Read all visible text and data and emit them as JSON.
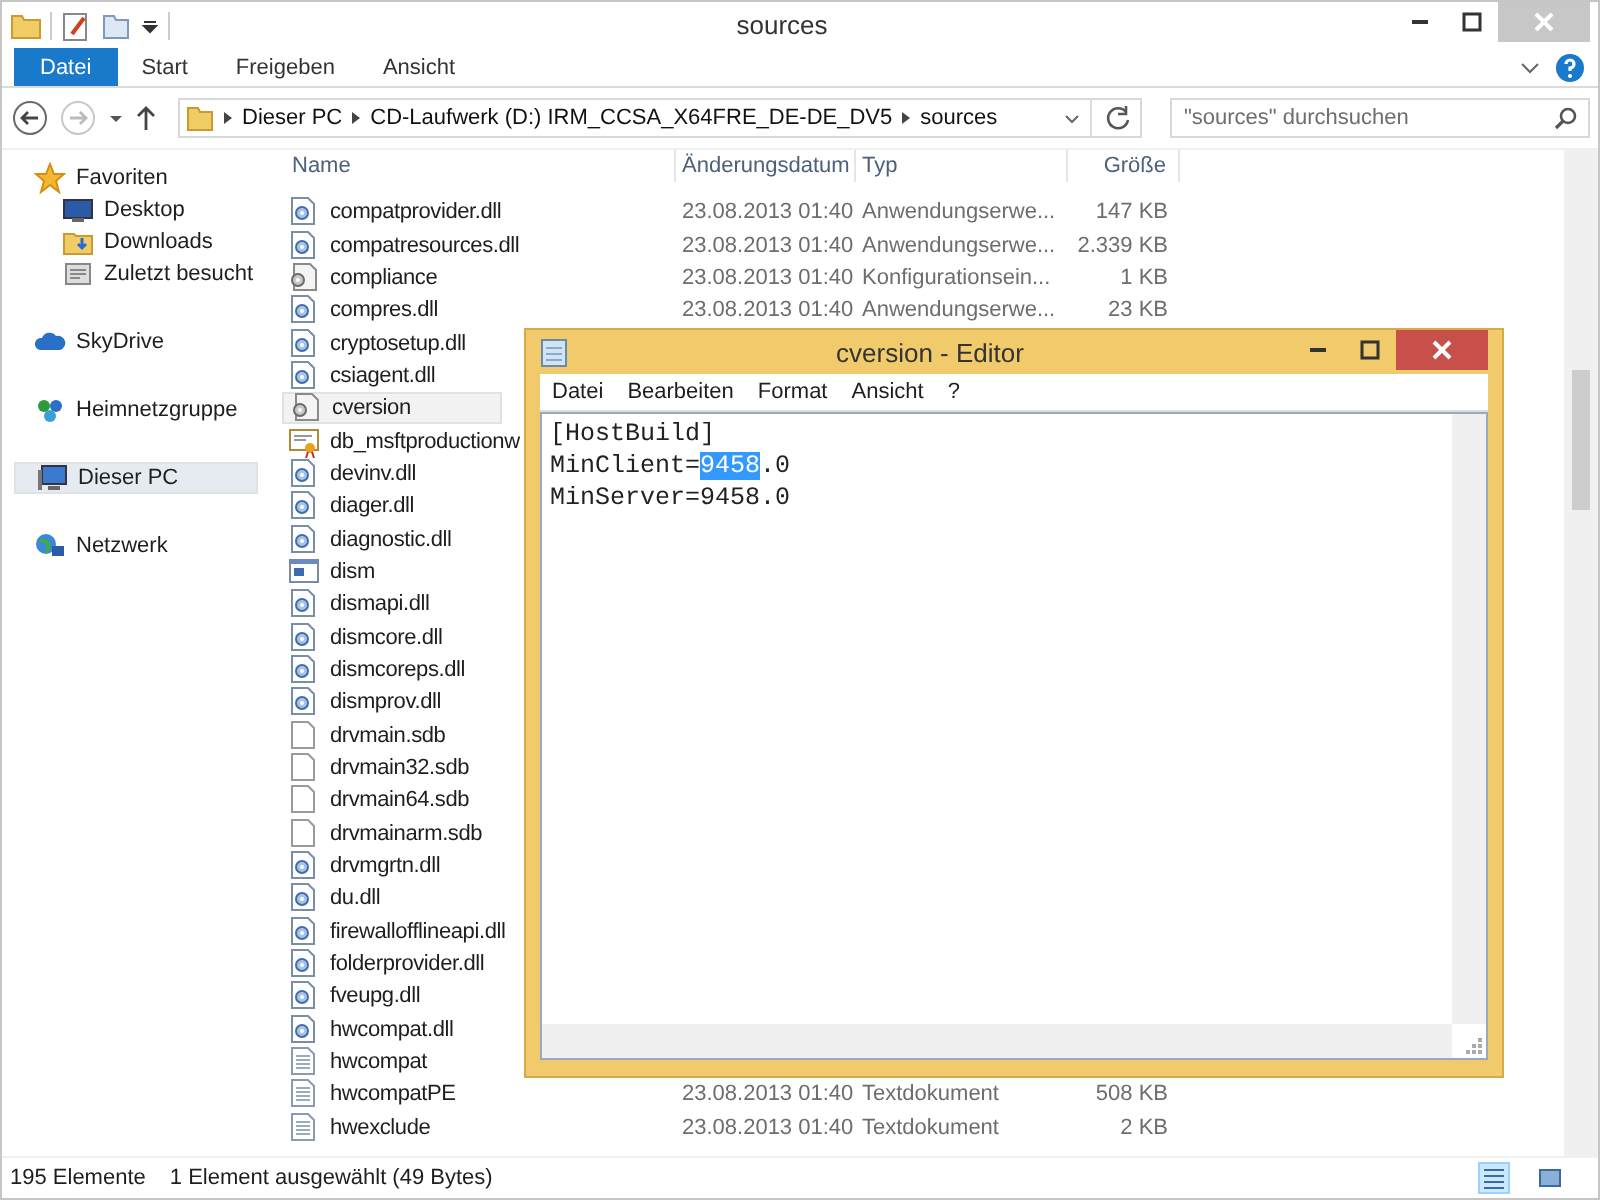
{
  "window": {
    "title": "sources"
  },
  "ribbon_tabs": [
    {
      "label": "Datei",
      "selected": true
    },
    {
      "label": "Start",
      "selected": false
    },
    {
      "label": "Freigeben",
      "selected": false
    },
    {
      "label": "Ansicht",
      "selected": false
    }
  ],
  "address_bar": {
    "breadcrumbs": [
      "Dieser PC",
      "CD-Laufwerk (D:) IRM_CCSA_X64FRE_DE-DE_DV5",
      "sources"
    ],
    "search": {
      "placeholder": "\"sources\" durchsuchen"
    }
  },
  "sidebar": {
    "groups": [
      {
        "items": [
          {
            "label": "Favoriten",
            "kind": "star",
            "selected": false,
            "children": [
              {
                "label": "Desktop",
                "kind": "desktop",
                "selected": false
              },
              {
                "label": "Downloads",
                "kind": "downloads",
                "selected": false
              },
              {
                "label": "Zuletzt besucht",
                "kind": "recent",
                "selected": false
              }
            ]
          }
        ]
      },
      {
        "items": [
          {
            "label": "SkyDrive",
            "kind": "cloud",
            "selected": false
          }
        ]
      },
      {
        "items": [
          {
            "label": "Heimnetzgruppe",
            "kind": "homegroup",
            "selected": false
          }
        ]
      },
      {
        "items": [
          {
            "label": "Dieser PC",
            "kind": "pc",
            "selected": true
          }
        ]
      },
      {
        "items": [
          {
            "label": "Netzwerk",
            "kind": "network",
            "selected": false
          }
        ]
      }
    ]
  },
  "table": {
    "columns": [
      "Name",
      "Änderungsdatum",
      "Typ",
      "Größe"
    ],
    "rows": [
      {
        "name": "compatprovider.dll",
        "kind": "dll",
        "selected": false,
        "date": "23.08.2013 01:40",
        "type": "Anwendungserwe...",
        "size": "147 KB"
      },
      {
        "name": "compatresources.dll",
        "kind": "dll",
        "selected": false,
        "date": "23.08.2013 01:40",
        "type": "Anwendungserwe...",
        "size": "2.339 KB"
      },
      {
        "name": "compliance",
        "kind": "config",
        "selected": false,
        "date": "23.08.2013 01:40",
        "type": "Konfigurationsein...",
        "size": "1 KB"
      },
      {
        "name": "compres.dll",
        "kind": "dll",
        "selected": false,
        "date": "23.08.2013 01:40",
        "type": "Anwendungserwe...",
        "size": "23 KB"
      },
      {
        "name": "cryptosetup.dll",
        "kind": "dll",
        "selected": false
      },
      {
        "name": "csiagent.dll",
        "kind": "dll",
        "selected": false
      },
      {
        "name": "cversion",
        "kind": "config",
        "selected": true
      },
      {
        "name": "db_msftproductionw",
        "kind": "cert",
        "selected": false
      },
      {
        "name": "devinv.dll",
        "kind": "dll",
        "selected": false
      },
      {
        "name": "diager.dll",
        "kind": "dll",
        "selected": false
      },
      {
        "name": "diagnostic.dll",
        "kind": "dll",
        "selected": false
      },
      {
        "name": "dism",
        "kind": "app",
        "selected": false
      },
      {
        "name": "dismapi.dll",
        "kind": "dll",
        "selected": false
      },
      {
        "name": "dismcore.dll",
        "kind": "dll",
        "selected": false
      },
      {
        "name": "dismcoreps.dll",
        "kind": "dll",
        "selected": false
      },
      {
        "name": "dismprov.dll",
        "kind": "dll",
        "selected": false
      },
      {
        "name": "drvmain.sdb",
        "kind": "file",
        "selected": false
      },
      {
        "name": "drvmain32.sdb",
        "kind": "file",
        "selected": false
      },
      {
        "name": "drvmain64.sdb",
        "kind": "file",
        "selected": false
      },
      {
        "name": "drvmainarm.sdb",
        "kind": "file",
        "selected": false
      },
      {
        "name": "drvmgrtn.dll",
        "kind": "dll",
        "selected": false
      },
      {
        "name": "du.dll",
        "kind": "dll",
        "selected": false
      },
      {
        "name": "firewallofflineapi.dll",
        "kind": "dll",
        "selected": false
      },
      {
        "name": "folderprovider.dll",
        "kind": "dll",
        "selected": false
      },
      {
        "name": "fveupg.dll",
        "kind": "dll",
        "selected": false
      },
      {
        "name": "hwcompat.dll",
        "kind": "dll",
        "selected": false
      },
      {
        "name": "hwcompat",
        "kind": "text",
        "selected": false
      },
      {
        "name": "hwcompatPE",
        "kind": "text",
        "selected": false,
        "date": "23.08.2013 01:40",
        "type": "Textdokument",
        "size": "508 KB"
      },
      {
        "name": "hwexclude",
        "kind": "text",
        "selected": false,
        "date": "23.08.2013 01:40",
        "type": "Textdokument",
        "size": "2 KB"
      }
    ]
  },
  "status_bar": {
    "count": "195 Elemente",
    "selection": "1 Element ausgewählt (49 Bytes)",
    "views": [
      {
        "kind": "details",
        "selected": true
      },
      {
        "kind": "tiles",
        "selected": false
      }
    ]
  },
  "notepad": {
    "title": "cversion - Editor",
    "menu": [
      "Datei",
      "Bearbeiten",
      "Format",
      "Ansicht",
      "?"
    ],
    "lines": [
      {
        "segments": [
          {
            "text": "[HostBuild]",
            "selected": false
          }
        ]
      },
      {
        "segments": [
          {
            "text": "MinClient=",
            "selected": false
          },
          {
            "text": "9458",
            "selected": true
          },
          {
            "text": ".0",
            "selected": false
          }
        ]
      },
      {
        "segments": [
          {
            "text": "MinServer=9458.0",
            "selected": false
          }
        ]
      }
    ]
  }
}
